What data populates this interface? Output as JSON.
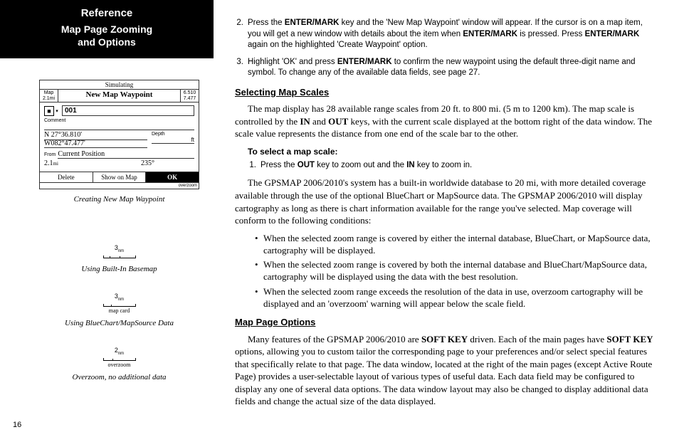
{
  "header": {
    "title": "Reference",
    "subtitle_l1": "Map Page Zooming",
    "subtitle_l2": "and Options"
  },
  "figure1": {
    "simulating": "Simulating",
    "side_left_l1": "Map",
    "side_left_l2": "2.1mi",
    "title": "New Map Waypoint",
    "side_right_l1": "6.510",
    "side_right_l2": "7.477",
    "marker": "■",
    "dropdown": "▾",
    "name": "001",
    "comment_label": "Comment",
    "coord_l1": "N  27°36.810'",
    "coord_l2": "W082°47.477'",
    "depth_label": "Depth",
    "depth_unit": "ft",
    "from_label": "From",
    "from_value": "Current Position",
    "dist": "2.1",
    "dist_unit": "mi",
    "bearing": "235°",
    "btn_delete": "Delete",
    "btn_show": "Show on Map",
    "btn_ok": "OK",
    "overzoom": "overzoom",
    "caption": "Creating New Map Waypoint"
  },
  "scales": {
    "s1_num": "3",
    "s1_unit": "n",
    "s1_sub": "m",
    "s1_caption": "Using Built-In Basemap",
    "s2_num": "3",
    "s2_unit": "n",
    "s2_sub": "m",
    "s2_label": "map card",
    "s2_caption": "Using BlueChart/MapSource Data",
    "s3_num": "2",
    "s3_unit": "n",
    "s3_sub": "m",
    "s3_label": "overzoom",
    "s3_caption": "Overzoom, no additional data"
  },
  "page_num": "16",
  "step2": {
    "num": "2.",
    "p1": "Press the ",
    "k1": "ENTER/MARK",
    "p2": " key and the 'New Map Waypoint' window will appear. If the cursor is on a map item, you will get a new window with details about the item when ",
    "k2": "ENTER/MARK",
    "p3": " is pressed. Press ",
    "k3": "ENTER/MARK",
    "p4": " again on the highlighted 'Create Waypoint' option."
  },
  "step3": {
    "num": "3.",
    "p1": "Highlight 'OK' and press ",
    "k1": "ENTER/MARK",
    "p2": " to confirm the new waypoint using the default three-digit name and symbol. To change any of the available data fields, see page 27."
  },
  "sec1": {
    "title": "Selecting Map Scales",
    "para": "The map display has 28 available range scales from 20 ft. to 800 mi. (5 m to 1200 km). The map scale is controlled by the ",
    "k1": "IN",
    "mid1": " and ",
    "k2": "OUT",
    "para2": " keys, with the current scale displayed at the bottom right of the data window. The scale value represents the distance from one end of the scale bar to the other.",
    "sub": "To select a map scale:",
    "step1_num": "1.",
    "step1_p1": "Press the ",
    "step1_k1": "OUT",
    "step1_p2": " key to zoom out and the ",
    "step1_k2": "IN",
    "step1_p3": " key to zoom in.",
    "para3": "The GPSMAP 2006/2010's system has a built-in worldwide database to 20 mi, with more detailed coverage available through the use of the optional BlueChart or MapSource data. The GPSMAP 2006/2010 will display cartography as long as there is chart information available for the range you've selected. Map coverage will conform to the following conditions:",
    "b1": "When the selected zoom range is covered by either the internal database, BlueChart, or MapSource data, cartography will be displayed.",
    "b2": "When the selected zoom range is covered by both the internal database and BlueChart/MapSource data, cartography will be displayed using the data with the best resolution.",
    "b3": "When the selected zoom range exceeds the resolution of the data in use, overzoom cartography will be displayed and an 'overzoom' warning will appear below the scale field."
  },
  "sec2": {
    "title": "Map Page Options",
    "p1": "Many features of the GPSMAP 2006/2010 are ",
    "k1": "SOFT KEY",
    "p2": " driven. Each of the main pages have ",
    "k2": "SOFT KEY",
    "p3": " options, allowing you to custom tailor the corresponding page to your preferences and/or select special features that specifically relate to that page. The data window, located at the right of the main pages (except Active Route Page) provides a user-selectable layout of various types of useful data. Each data field may be configured to display any one of several data options. The data window layout may also be changed to display additional data fields and change the actual size of the data displayed."
  }
}
